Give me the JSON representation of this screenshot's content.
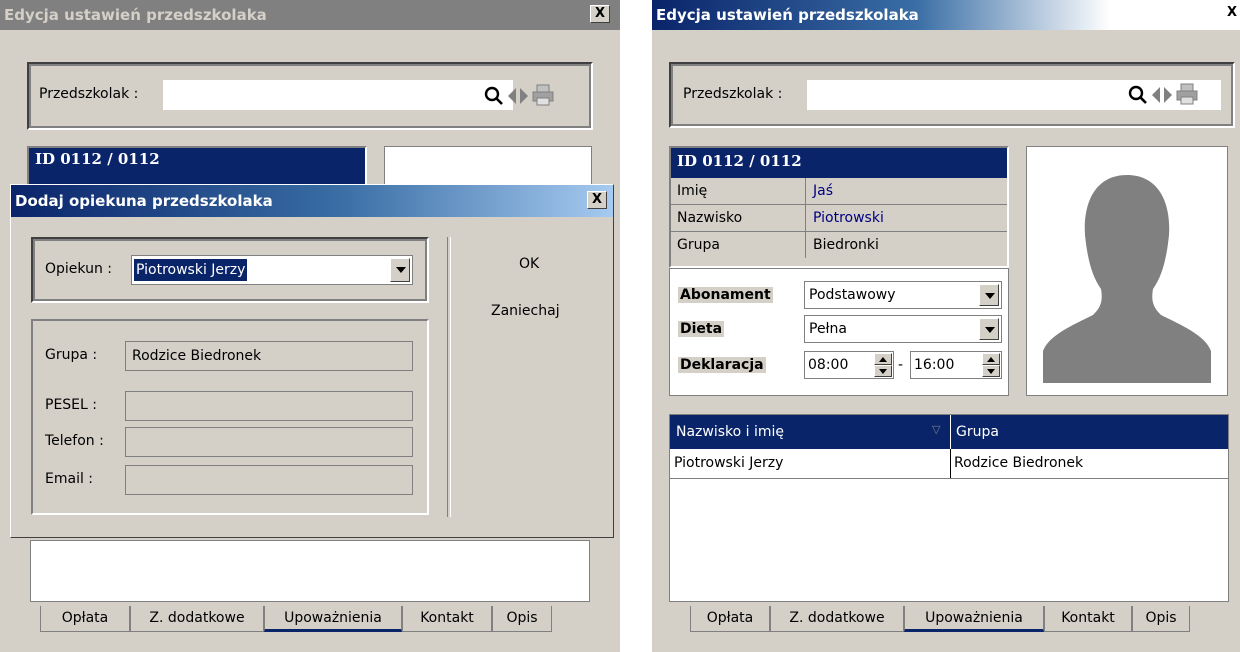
{
  "colors": {
    "face": "#d4d0c8",
    "header_blue": "#0a246a",
    "link_blue": "#000080",
    "selected_row": "#0a246a"
  },
  "left": {
    "title": "Edycja ustawień przedszkolaka",
    "close_label": "X",
    "search": {
      "label": "Przedszkolak :",
      "value": ""
    },
    "id_header": "ID 0112 / 0112",
    "tabs": [
      "Opłata",
      "Z. dodatkowe",
      "Upoważnienia",
      "Kontakt",
      "Opis"
    ],
    "active_tab": "Upoważnienia"
  },
  "dialog": {
    "title": "Dodaj opiekuna przedszkolaka",
    "close_label": "X",
    "guardian_label": "Opiekun :",
    "guardian_value": "Piotrowski Jerzy",
    "group_label": "Grupa :",
    "group_value": "Rodzice Biedronek",
    "pesel_label": "PESEL :",
    "phone_label": "Telefon :",
    "email_label": "Email :",
    "ok_label": "OK",
    "cancel_label": "Zaniechaj"
  },
  "right": {
    "title": "Edycja ustawień przedszkolaka",
    "close_label": "X",
    "search": {
      "label": "Przedszkolak :",
      "value": ""
    },
    "id_header": "ID 0112 / 0112",
    "info": [
      {
        "label": "Imię",
        "value": "Jaś"
      },
      {
        "label": "Nazwisko",
        "value": "Piotrowski"
      },
      {
        "label": "Grupa",
        "value": "Biedronki"
      }
    ],
    "settings": {
      "subscription_label": "Abonament",
      "subscription_value": "Podstawowy",
      "diet_label": "Dieta",
      "diet_value": "Pełna",
      "declaration_label": "Deklaracja",
      "time_from": "08:00",
      "time_separator": "-",
      "time_to": "16:00"
    },
    "table": {
      "columns": [
        "Nazwisko i imię",
        "Grupa"
      ],
      "rows": [
        {
          "name": "Piotrowski Jerzy",
          "group": "Rodzice Biedronek"
        }
      ]
    },
    "tabs": [
      "Opłata",
      "Z. dodatkowe",
      "Upoważnienia",
      "Kontakt",
      "Opis"
    ],
    "active_tab": "Upoważnienia"
  }
}
